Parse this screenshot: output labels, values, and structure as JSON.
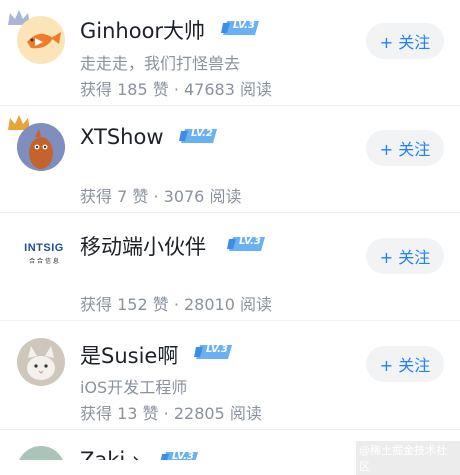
{
  "users": [
    {
      "name": "Ginhoor大帅",
      "level": "LV.3",
      "desc": "走走走，我们打怪兽去",
      "likes_label": "获得 185 赞",
      "dot": "·",
      "reads_label": "47683 阅读",
      "follow_label": "+ 关注",
      "avatar": "fish-avatar-icon"
    },
    {
      "name": "XTShow",
      "level": "LV.2",
      "desc": "",
      "likes_label": "获得 7 赞",
      "dot": "·",
      "reads_label": "3076 阅读",
      "follow_label": "+ 关注",
      "avatar": "bird-avatar-icon"
    },
    {
      "name": "移动端小伙伴",
      "level": "LV.3",
      "desc": "",
      "likes_label": "获得 152 赞",
      "dot": "·",
      "reads_label": "28010 阅读",
      "follow_label": "+ 关注",
      "avatar": "intsig-logo",
      "avatar_text": "INTSIG",
      "avatar_subtext": "合 合 信 息"
    },
    {
      "name": "是Susie啊",
      "level": "LV.3",
      "desc": "iOS开发工程师",
      "likes_label": "获得 13 赞",
      "dot": "·",
      "reads_label": "22805 阅读",
      "follow_label": "+ 关注",
      "avatar": "cat-avatar-icon"
    },
    {
      "name": "Zaki ›",
      "level": "LV.3",
      "avatar": "user-avatar-icon"
    }
  ],
  "watermark": "@稀土掘金技术社区",
  "colors": {
    "accent": "#1e80ff",
    "text": "#1d2129",
    "muted": "#8a919f",
    "button_bg": "#f2f3f5"
  }
}
